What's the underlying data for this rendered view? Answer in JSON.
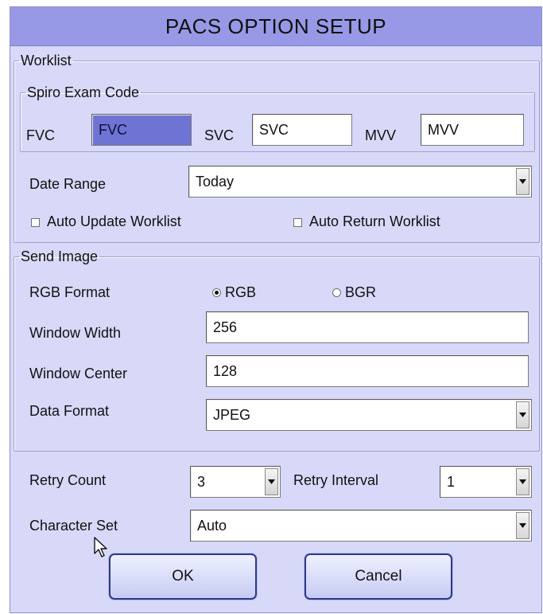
{
  "dialog": {
    "title": "PACS OPTION SETUP"
  },
  "worklist": {
    "legend": "Worklist",
    "spiro": {
      "legend": "Spiro Exam Code",
      "fvc_label": "FVC",
      "fvc_value": "FVC",
      "svc_label": "SVC",
      "svc_value": "SVC",
      "mvv_label": "MVV",
      "mvv_value": "MVV"
    },
    "date_range_label": "Date Range",
    "date_range_value": "Today",
    "auto_update_label": "Auto Update Worklist",
    "auto_update_checked": false,
    "auto_return_label": "Auto Return Worklist",
    "auto_return_checked": false
  },
  "send_image": {
    "legend": "Send Image",
    "rgb_format_label": "RGB Format",
    "rgb_option": "RGB",
    "bgr_option": "BGR",
    "selected_format": "RGB",
    "window_width_label": "Window Width",
    "window_width_value": "256",
    "window_center_label": "Window Center",
    "window_center_value": "128",
    "data_format_label": "Data Format",
    "data_format_value": "JPEG"
  },
  "retry": {
    "count_label": "Retry Count",
    "count_value": "3",
    "interval_label": "Retry Interval",
    "interval_value": "1"
  },
  "charset": {
    "label": "Character Set",
    "value": "Auto"
  },
  "buttons": {
    "ok": "OK",
    "cancel": "Cancel"
  },
  "icons": {
    "dropdown": "chevron-down-icon",
    "pointer": "mouse-pointer-icon"
  },
  "colors": {
    "dialog_bg": "#d8d9f9",
    "titlebar_bg": "#9799e6",
    "selected_field_bg": "#6f74d4",
    "button_border": "#2d3a8a"
  }
}
